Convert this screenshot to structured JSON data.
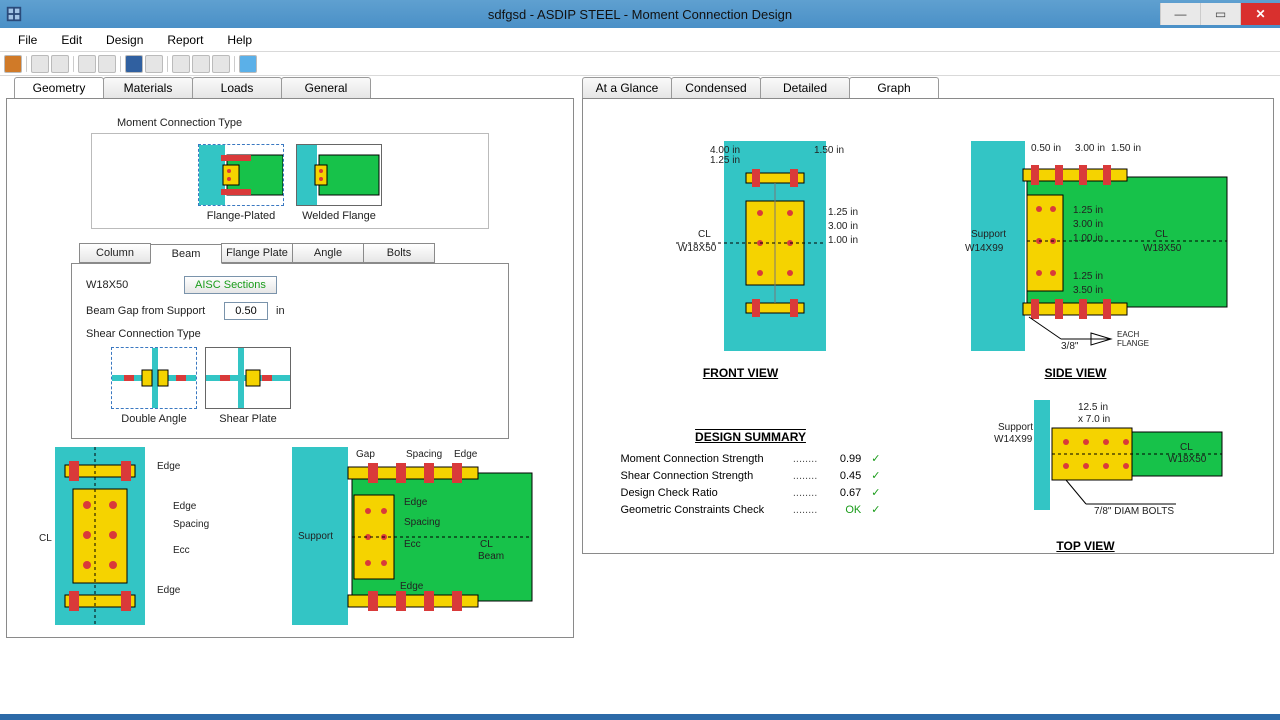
{
  "title": "sdfgsd - ASDIP STEEL - Moment Connection Design",
  "menu": {
    "file": "File",
    "edit": "Edit",
    "design": "Design",
    "report": "Report",
    "help": "Help"
  },
  "tabs_left": {
    "geometry": "Geometry",
    "materials": "Materials",
    "loads": "Loads",
    "general": "General"
  },
  "tabs_right": {
    "glance": "At a Glance",
    "condensed": "Condensed",
    "detailed": "Detailed",
    "graph": "Graph"
  },
  "group_moment": "Moment Connection Type",
  "conn_types": {
    "flange_plated": "Flange-Plated",
    "welded_flange": "Welded Flange"
  },
  "subtabs": {
    "column": "Column",
    "beam": "Beam",
    "flange_plate": "Flange Plate",
    "angle": "Angle",
    "bolts": "Bolts"
  },
  "beam": {
    "section_label": "W18X50",
    "aisc_btn": "AISC Sections",
    "gap_label": "Beam Gap from Support",
    "gap_value": "0.50",
    "gap_unit": "in",
    "shear_label": "Shear Connection Type",
    "shear_types": {
      "double_angle": "Double Angle",
      "shear_plate": "Shear Plate"
    }
  },
  "diag_left": {
    "edge": "Edge",
    "spacing": "Spacing",
    "ecc": "Ecc",
    "cl": "CL"
  },
  "diag_right": {
    "gap": "Gap",
    "spacing": "Spacing",
    "edge": "Edge",
    "ecc": "Ecc",
    "support": "Support",
    "cl": "CL",
    "beam": "Beam"
  },
  "front": {
    "title": "FRONT VIEW",
    "d1": "4.00 in",
    "d2": "1.25 in",
    "d3": "1.50 in",
    "d4": "1.25 in",
    "d5": "3.00 in",
    "d6": "1.00 in",
    "cl": "CL",
    "sect": "W18X50"
  },
  "side": {
    "title": "SIDE VIEW",
    "d0": "0.50 in",
    "d1": "3.00 in",
    "d2": "1.50 in",
    "d3": "1.25 in",
    "d4": "3.00 in",
    "d5": "1.00 in",
    "d6": "1.25 in",
    "d7": "3.50 in",
    "support": "Support",
    "supsect": "W14X99",
    "cl": "CL",
    "beamsect": "W18X50",
    "weld": "3/8\"",
    "flange": "EACH\nFLANGE"
  },
  "top": {
    "title": "TOP VIEW",
    "d1": "12.5 in",
    "d2": "x 7.0 in",
    "support": "Support",
    "supsect": "W14X99",
    "cl": "CL",
    "beamsect": "W18X50",
    "bolt": "7/8\" DIAM BOLTS"
  },
  "summary": {
    "title": "DESIGN SUMMARY",
    "r1k": "Moment Connection Strength",
    "r1v": "0.99",
    "r2k": "Shear Connection Strength",
    "r2v": "0.45",
    "r3k": "Design Check Ratio",
    "r3v": "0.67",
    "r4k": "Geometric Constraints Check",
    "r4v": "OK"
  }
}
